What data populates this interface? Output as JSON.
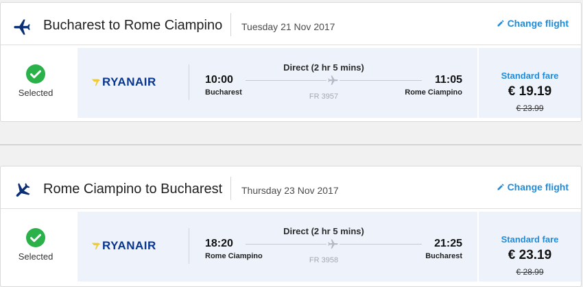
{
  "colors": {
    "accent": "#1f8cd9",
    "brand": "#073590",
    "check": "#2bb14a",
    "panel": "#edf2fb"
  },
  "flights": [
    {
      "route": "Bucharest to Rome Ciampino",
      "date": "Tuesday 21 Nov 2017",
      "change_label": "Change flight",
      "selected_label": "Selected",
      "airline": "RYANAIR",
      "dep_time": "10:00",
      "dep_city": "Bucharest",
      "arr_time": "11:05",
      "arr_city": "Rome Ciampino",
      "duration": "Direct (2 hr 5 mins)",
      "flight_no": "FR 3957",
      "fare_label": "Standard fare",
      "price": "€ 19.19",
      "old_price": "€ 23.99",
      "icon": "plane-departure-icon"
    },
    {
      "route": "Rome Ciampino to Bucharest",
      "date": "Thursday 23 Nov 2017",
      "change_label": "Change flight",
      "selected_label": "Selected",
      "airline": "RYANAIR",
      "dep_time": "18:20",
      "dep_city": "Rome Ciampino",
      "arr_time": "21:25",
      "arr_city": "Bucharest",
      "duration": "Direct (2 hr 5 mins)",
      "flight_no": "FR 3958",
      "fare_label": "Standard fare",
      "price": "€ 23.19",
      "old_price": "€ 28.99",
      "icon": "plane-arrival-icon"
    }
  ]
}
